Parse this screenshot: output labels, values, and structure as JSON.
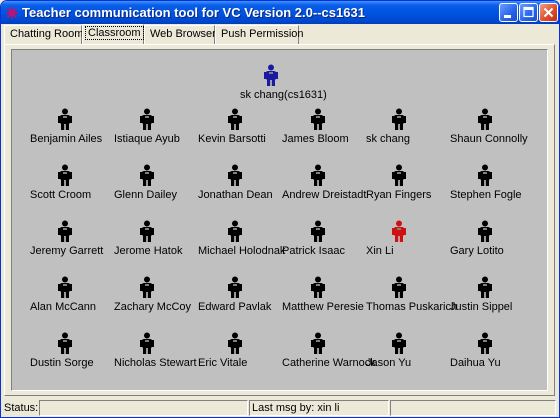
{
  "window": {
    "title": "Teacher communication tool for VC  Version 2.0--cs1631",
    "icon": "app-icon"
  },
  "tabs": [
    {
      "label": "Chatting Room"
    },
    {
      "label": "Classroom"
    },
    {
      "label": "Web Browser"
    },
    {
      "label": "Push Permission"
    }
  ],
  "classroom": {
    "teacher": {
      "name": "sk chang(cs1631)",
      "icon": "teacher-icon",
      "color": "#1a1aa0"
    },
    "student_icon_color": "#000000",
    "highlight_color": "#d01010",
    "students": [
      {
        "name": "Benjamin Ailes"
      },
      {
        "name": "Istiaque Ayub"
      },
      {
        "name": "Kevin Barsotti"
      },
      {
        "name": "James Bloom"
      },
      {
        "name": "sk chang"
      },
      {
        "name": "Shaun Connolly"
      },
      {
        "name": "Scott Croom"
      },
      {
        "name": "Glenn Dailey"
      },
      {
        "name": "Jonathan Dean"
      },
      {
        "name": "Andrew Dreistadt"
      },
      {
        "name": "Ryan Fingers"
      },
      {
        "name": "Stephen Fogle"
      },
      {
        "name": "Jeremy Garrett"
      },
      {
        "name": "Jerome Hatok"
      },
      {
        "name": "Michael Holodnak"
      },
      {
        "name": "Patrick Isaac"
      },
      {
        "name": "Xin Li",
        "highlighted": true
      },
      {
        "name": "Gary Lotito"
      },
      {
        "name": "Alan McCann"
      },
      {
        "name": "Zachary McCoy"
      },
      {
        "name": "Edward Pavlak"
      },
      {
        "name": "Matthew Peresie"
      },
      {
        "name": "Thomas Puskarich"
      },
      {
        "name": "Justin Sippel"
      },
      {
        "name": "Dustin Sorge"
      },
      {
        "name": "Nicholas Stewart"
      },
      {
        "name": "Eric Vitale"
      },
      {
        "name": "Catherine Warnock"
      },
      {
        "name": "Jason Yu"
      },
      {
        "name": "Daihua Yu"
      }
    ]
  },
  "statusbar": {
    "status_label": "Status:",
    "status_text": "",
    "last_msg": "Last msg by: xin li",
    "extra": ""
  }
}
